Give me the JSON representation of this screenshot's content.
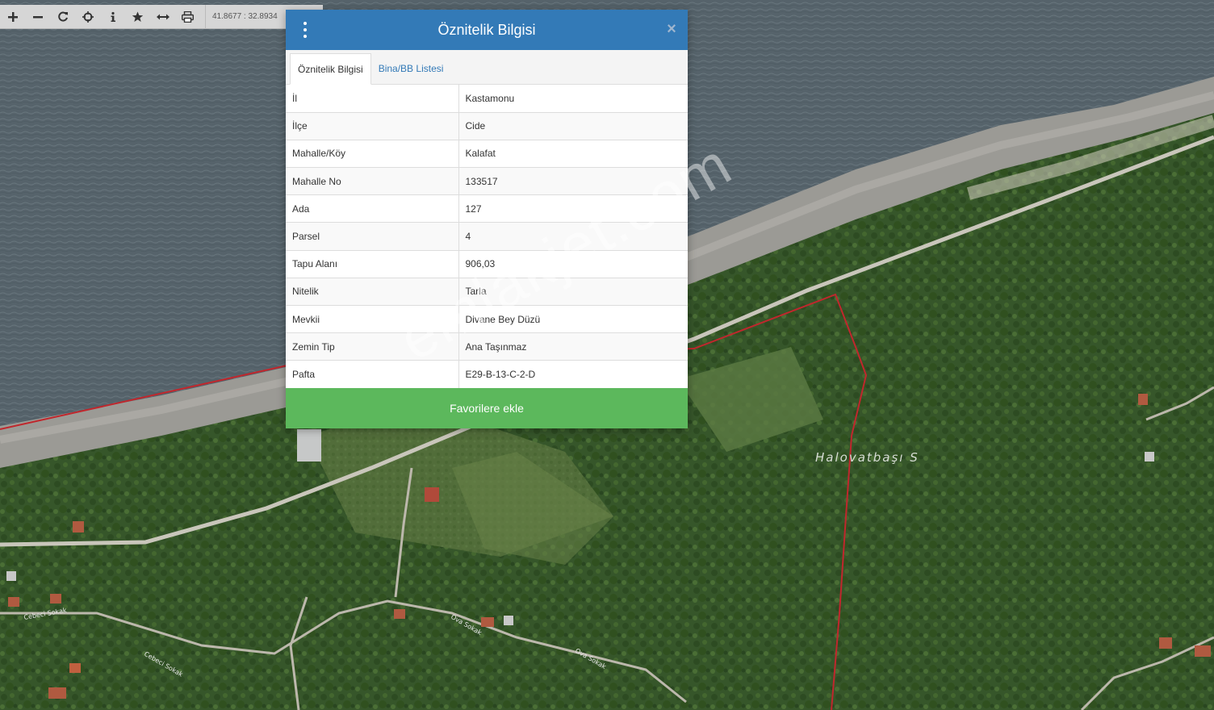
{
  "toolbar": {
    "buttons": [
      {
        "name": "zoom-in",
        "icon": "plus-icon"
      },
      {
        "name": "zoom-out",
        "icon": "minus-icon"
      },
      {
        "name": "refresh",
        "icon": "refresh-icon"
      },
      {
        "name": "locate",
        "icon": "crosshair-icon"
      },
      {
        "name": "info",
        "icon": "info-icon"
      },
      {
        "name": "favorites",
        "icon": "star-icon"
      },
      {
        "name": "measure",
        "icon": "measure-icon"
      },
      {
        "name": "print",
        "icon": "print-icon"
      }
    ],
    "coordinates": "41.8677 : 32.8934"
  },
  "dialog": {
    "title": "Öznitelik Bilgisi",
    "tabs": [
      {
        "label": "Öznitelik Bilgisi",
        "active": true
      },
      {
        "label": "Bina/BB Listesi",
        "active": false
      }
    ],
    "rows": [
      {
        "key": "İl",
        "value": "Kastamonu"
      },
      {
        "key": "İlçe",
        "value": "Cide"
      },
      {
        "key": "Mahalle/Köy",
        "value": "Kalafat"
      },
      {
        "key": "Mahalle No",
        "value": "133517"
      },
      {
        "key": "Ada",
        "value": "127"
      },
      {
        "key": "Parsel",
        "value": "4"
      },
      {
        "key": "Tapu Alanı",
        "value": "906,03"
      },
      {
        "key": "Nitelik",
        "value": "Tarla"
      },
      {
        "key": "Mevkii",
        "value": "Divane Bey Düzü"
      },
      {
        "key": "Zemin Tip",
        "value": "Ana Taşınmaz"
      },
      {
        "key": "Pafta",
        "value": "E29-B-13-C-2-D"
      }
    ],
    "favorite_button": "Favorilere ekle"
  },
  "map": {
    "labels": {
      "place": "Halovatbaşı S",
      "street1": "Cebeci Sokak",
      "street2": "Cebeci Sokak",
      "street3": "Ova Sokak",
      "street4": "Ova Sokak"
    }
  },
  "watermark": "emlakjet.com",
  "colors": {
    "header": "#337ab7",
    "favorite": "#5cb85c",
    "parcel_border": "#c0272d",
    "sea": "#55626a",
    "land": "#3b5a2c"
  }
}
